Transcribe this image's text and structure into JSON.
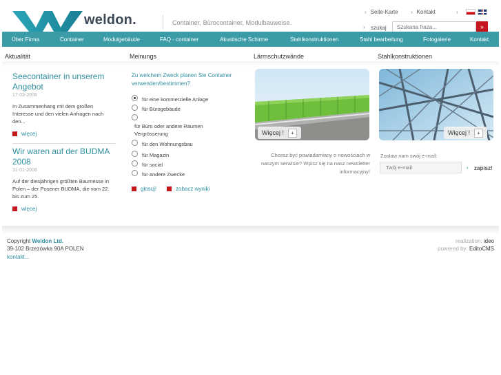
{
  "header": {
    "logo_text": "weldon.",
    "tagline": "Container, Bürocontainer, Modulbauweise.",
    "sitemap_label": "Seite-Karte",
    "contact_label": "Kontakt",
    "search_label": "szukaj",
    "search_placeholder": "Szukana fraza...",
    "search_button": "»"
  },
  "nav": {
    "items": [
      "Über Firma",
      "Container",
      "Modulgebäude",
      "FAQ - container",
      "Akustische Schirme",
      "Stahlkonstruktionen",
      "Stahl bearbeitung",
      "Fotogalerie",
      "Kontakt"
    ]
  },
  "columns": {
    "news_head": "Aktualität",
    "poll_head": "Meinungs",
    "noise_head": "Lärmschutzwände",
    "steel_head": "Stahlkonstruktionen"
  },
  "news": [
    {
      "title": "Seecontainer in unserem Angebot",
      "date": "17-03-2008",
      "text": "In Zusammenhang mit dem großen Interesse und den vielen Anfragen nach den...",
      "more": "więcej"
    },
    {
      "title": "Wir waren auf der BUDMA 2008",
      "date": "31-01-2008",
      "text": "Auf der diesjährigen größten Baumesse in Polen – der Posener BUDMA, die vom 22. bis zum 25.",
      "more": "więcej"
    }
  ],
  "poll": {
    "question": "Zu welchem Zweck planen Sie Container verwenden/bestimmen?",
    "options": [
      "für eine kommerzielle Anlage",
      "für Bürogebäude",
      "für Büro oder andere Räumen Vergrösserung",
      "für den Wohnungsbau",
      "für Magazin",
      "für social",
      "für andere Zwecke"
    ],
    "selected": 0,
    "vote": "głosuj!",
    "results": "zobacz wyniki"
  },
  "promo": {
    "more_label": "Więcej !",
    "plus": "+",
    "newsletter_text": "Chcesz być powiadamiany o nowościach w naszym serwisie? Wpisz się na nasz newsletter informacyjny!",
    "email_label": "Zostaw nam swój e-mail:",
    "email_placeholder": "Twój e-mail",
    "submit": "zapisz!"
  },
  "footer": {
    "copyright": "Copyright",
    "company": "Weldon Ltd.",
    "address": "39-102 Brzezówka 90A POLEN",
    "contact": "kontakt...",
    "realization_label": "realization:",
    "realization_value": "ideo",
    "powered_label": "powered by:",
    "powered_value": "EditoCMS"
  },
  "colors": {
    "accent": "#3b9ca8",
    "link": "#2f8fa0",
    "red": "#c4161c"
  }
}
